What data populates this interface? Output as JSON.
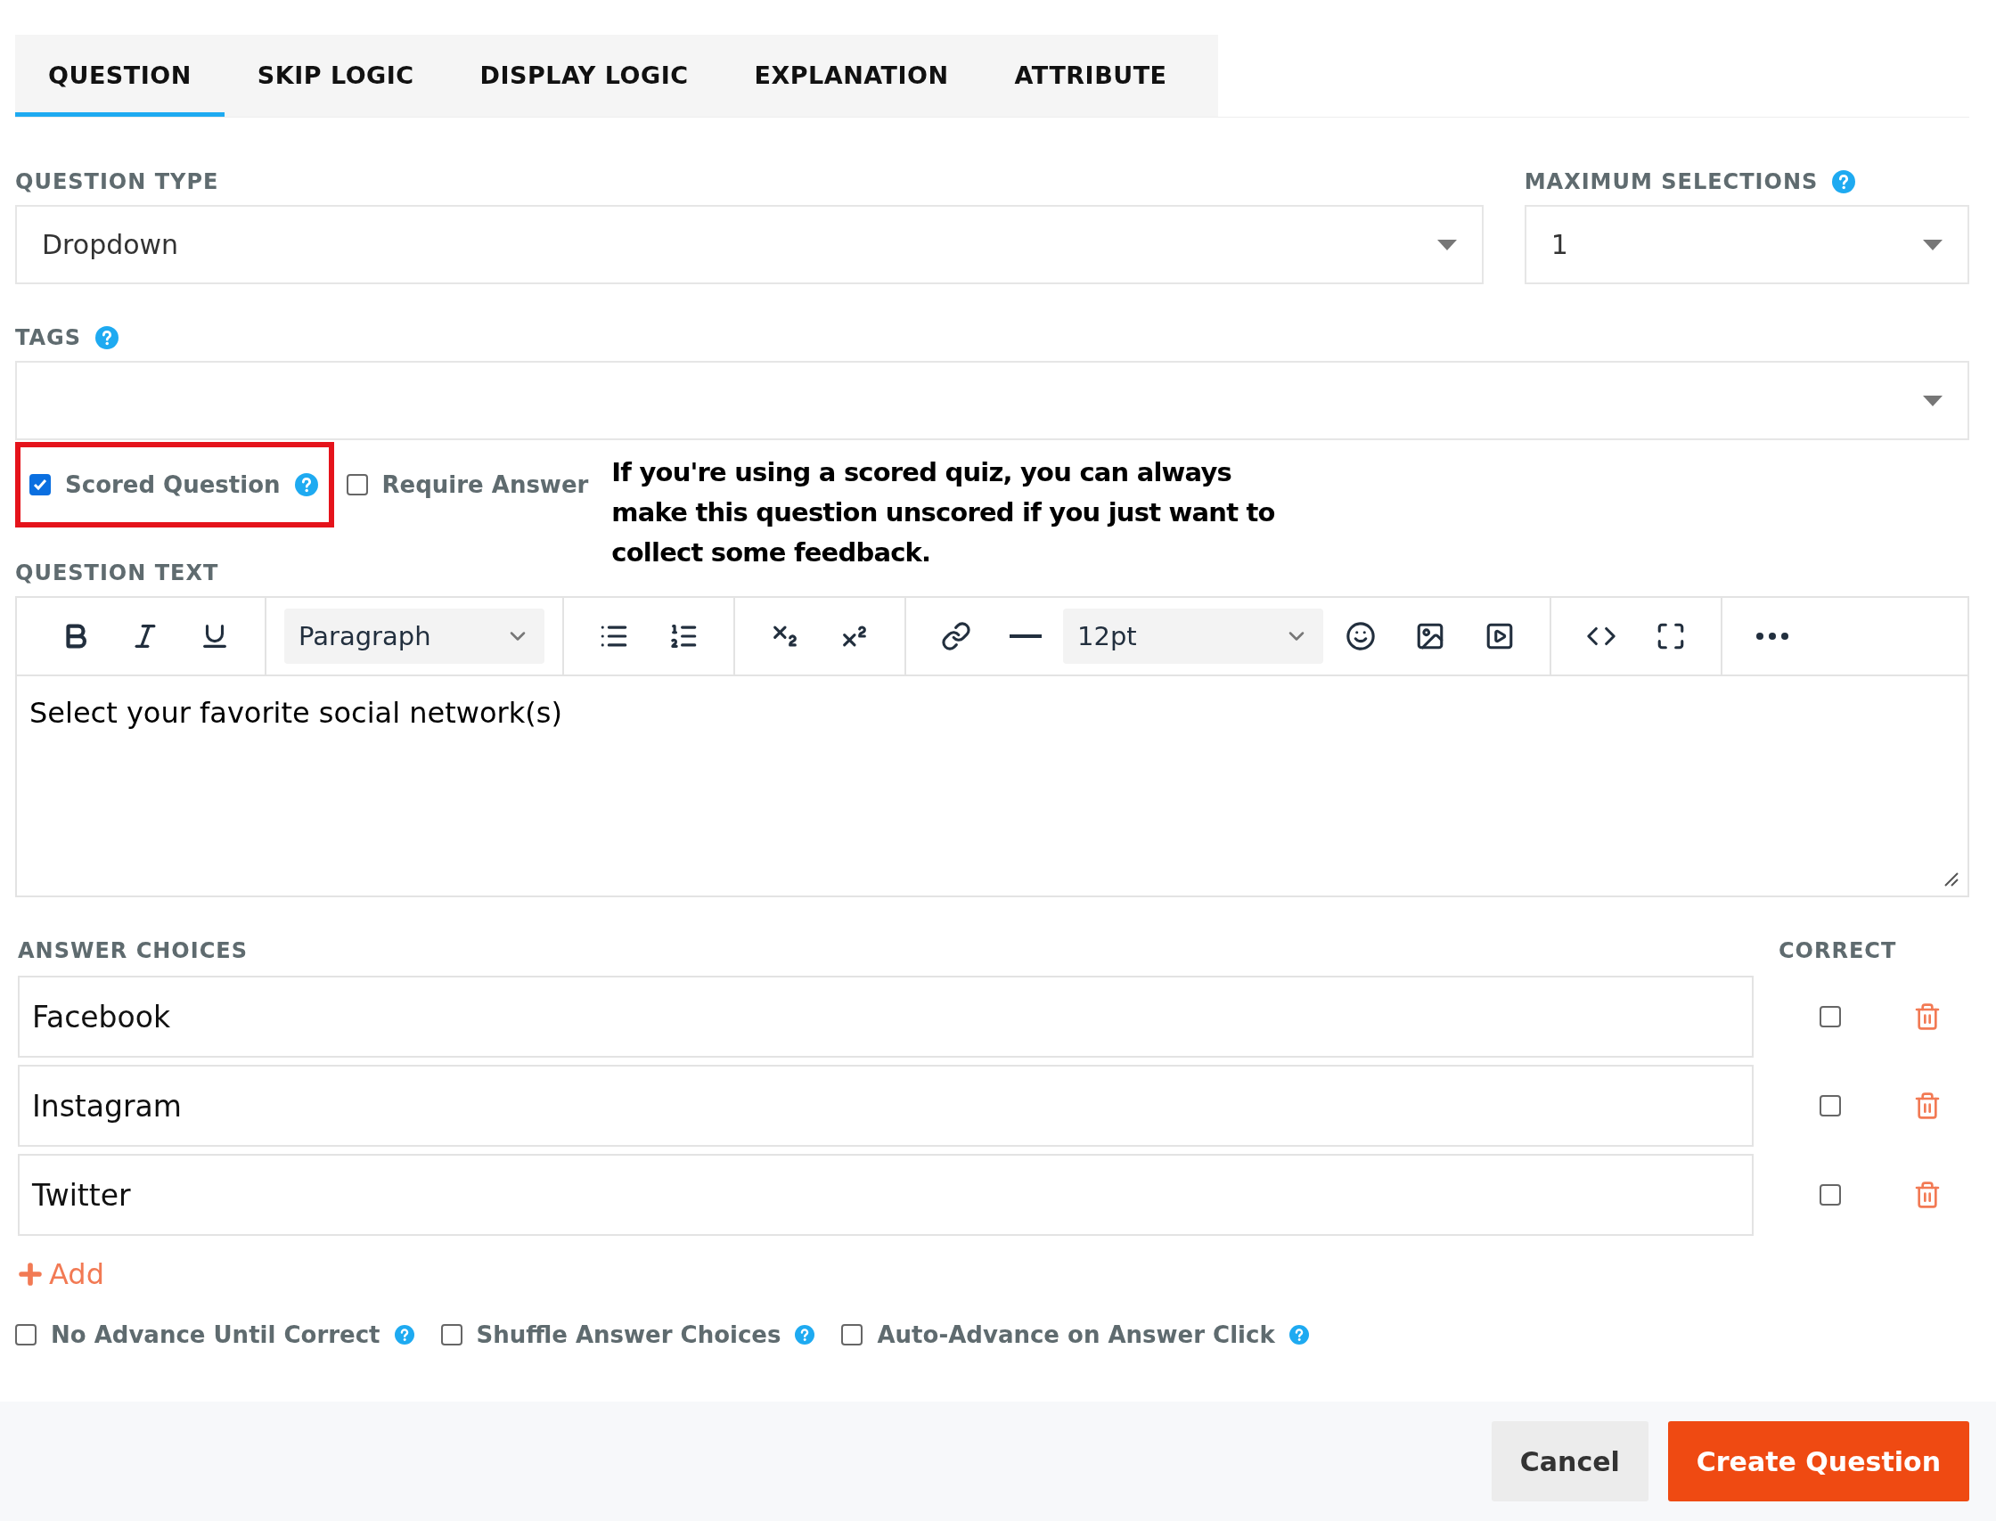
{
  "tabs": [
    {
      "label": "QUESTION",
      "selected": true
    },
    {
      "label": "SKIP LOGIC",
      "selected": false
    },
    {
      "label": "DISPLAY LOGIC",
      "selected": false
    },
    {
      "label": "EXPLANATION",
      "selected": false
    },
    {
      "label": "ATTRIBUTE",
      "selected": false
    }
  ],
  "question_type": {
    "label": "QUESTION TYPE",
    "value": "Dropdown",
    "help": false
  },
  "maximum_selections": {
    "label": "MAXIMUM SELECTIONS",
    "value": "1",
    "help": true
  },
  "tags": {
    "label": "TAGS",
    "help": true
  },
  "question_options": [
    {
      "label": "Scored Question",
      "checked": true,
      "help": true,
      "highlighted": true
    },
    {
      "label": "Require Answer",
      "checked": false,
      "help": false,
      "highlighted": false
    }
  ],
  "annotation": "If you're using a scored quiz, you can always make this question unscored if you just want to collect some feedback.",
  "question_text": {
    "label": "QUESTION TEXT",
    "block_format": "Paragraph",
    "font_size": "12pt",
    "content": "Select your favorite social network(s)"
  },
  "answer_choices": {
    "label": "ANSWER CHOICES",
    "correct_label": "CORRECT",
    "add_label": "Add",
    "items": [
      {
        "text": "Facebook",
        "correct": false
      },
      {
        "text": "Instagram",
        "correct": false
      },
      {
        "text": "Twitter",
        "correct": false
      }
    ]
  },
  "settings": [
    {
      "label": "No Advance Until Correct",
      "checked": false
    },
    {
      "label": "Shuffle Answer Choices",
      "checked": false
    },
    {
      "label": "Auto-Advance on Answer Click",
      "checked": false
    }
  ],
  "buttons": [
    {
      "label": "Cancel",
      "kind": "secondary"
    },
    {
      "label": "Create Question",
      "kind": "primary"
    }
  ]
}
